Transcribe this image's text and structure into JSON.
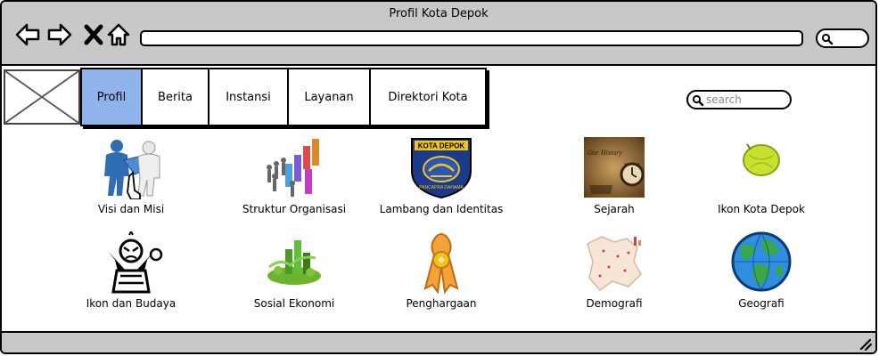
{
  "window": {
    "title": "Profil Kota Depok"
  },
  "browser": {
    "address_value": "",
    "icons": [
      "back-arrow-icon",
      "forward-arrow-icon",
      "close-x-icon",
      "home-icon",
      "search-icon"
    ]
  },
  "nav": {
    "tabs": [
      {
        "label": "Profil",
        "active": true
      },
      {
        "label": "Berita",
        "active": false
      },
      {
        "label": "Instansi",
        "active": false
      },
      {
        "label": "Layanan",
        "active": false
      },
      {
        "label": "Direktori Kota",
        "active": false
      }
    ],
    "search_placeholder": "search",
    "active_color": "#8fb4ec"
  },
  "menu": {
    "row1": [
      {
        "label": "Visi dan Misi",
        "icon": "puzzle-people-icon"
      },
      {
        "label": "Struktur Organisasi",
        "icon": "org-structure-icon"
      },
      {
        "label": "Lambang dan Identitas",
        "icon": "city-emblem-icon",
        "emblem_text_top": "KOTA DEPOK",
        "emblem_text_bottom": "PANCAPRA DAHAMA"
      },
      {
        "label": "Sejarah",
        "icon": "history-clock-icon",
        "image_text": "Our History"
      },
      {
        "label": "Ikon Kota Depok",
        "icon": "starfruit-icon"
      }
    ],
    "row2": [
      {
        "label": "Ikon dan Budaya",
        "icon": "culture-mask-icon"
      },
      {
        "label": "Sosial Ekonomi",
        "icon": "economy-chart-icon"
      },
      {
        "label": "Penghargaan",
        "icon": "award-ribbon-icon"
      },
      {
        "label": "Demografi",
        "icon": "demographic-map-icon"
      },
      {
        "label": "Geografi",
        "icon": "globe-icon"
      }
    ]
  }
}
